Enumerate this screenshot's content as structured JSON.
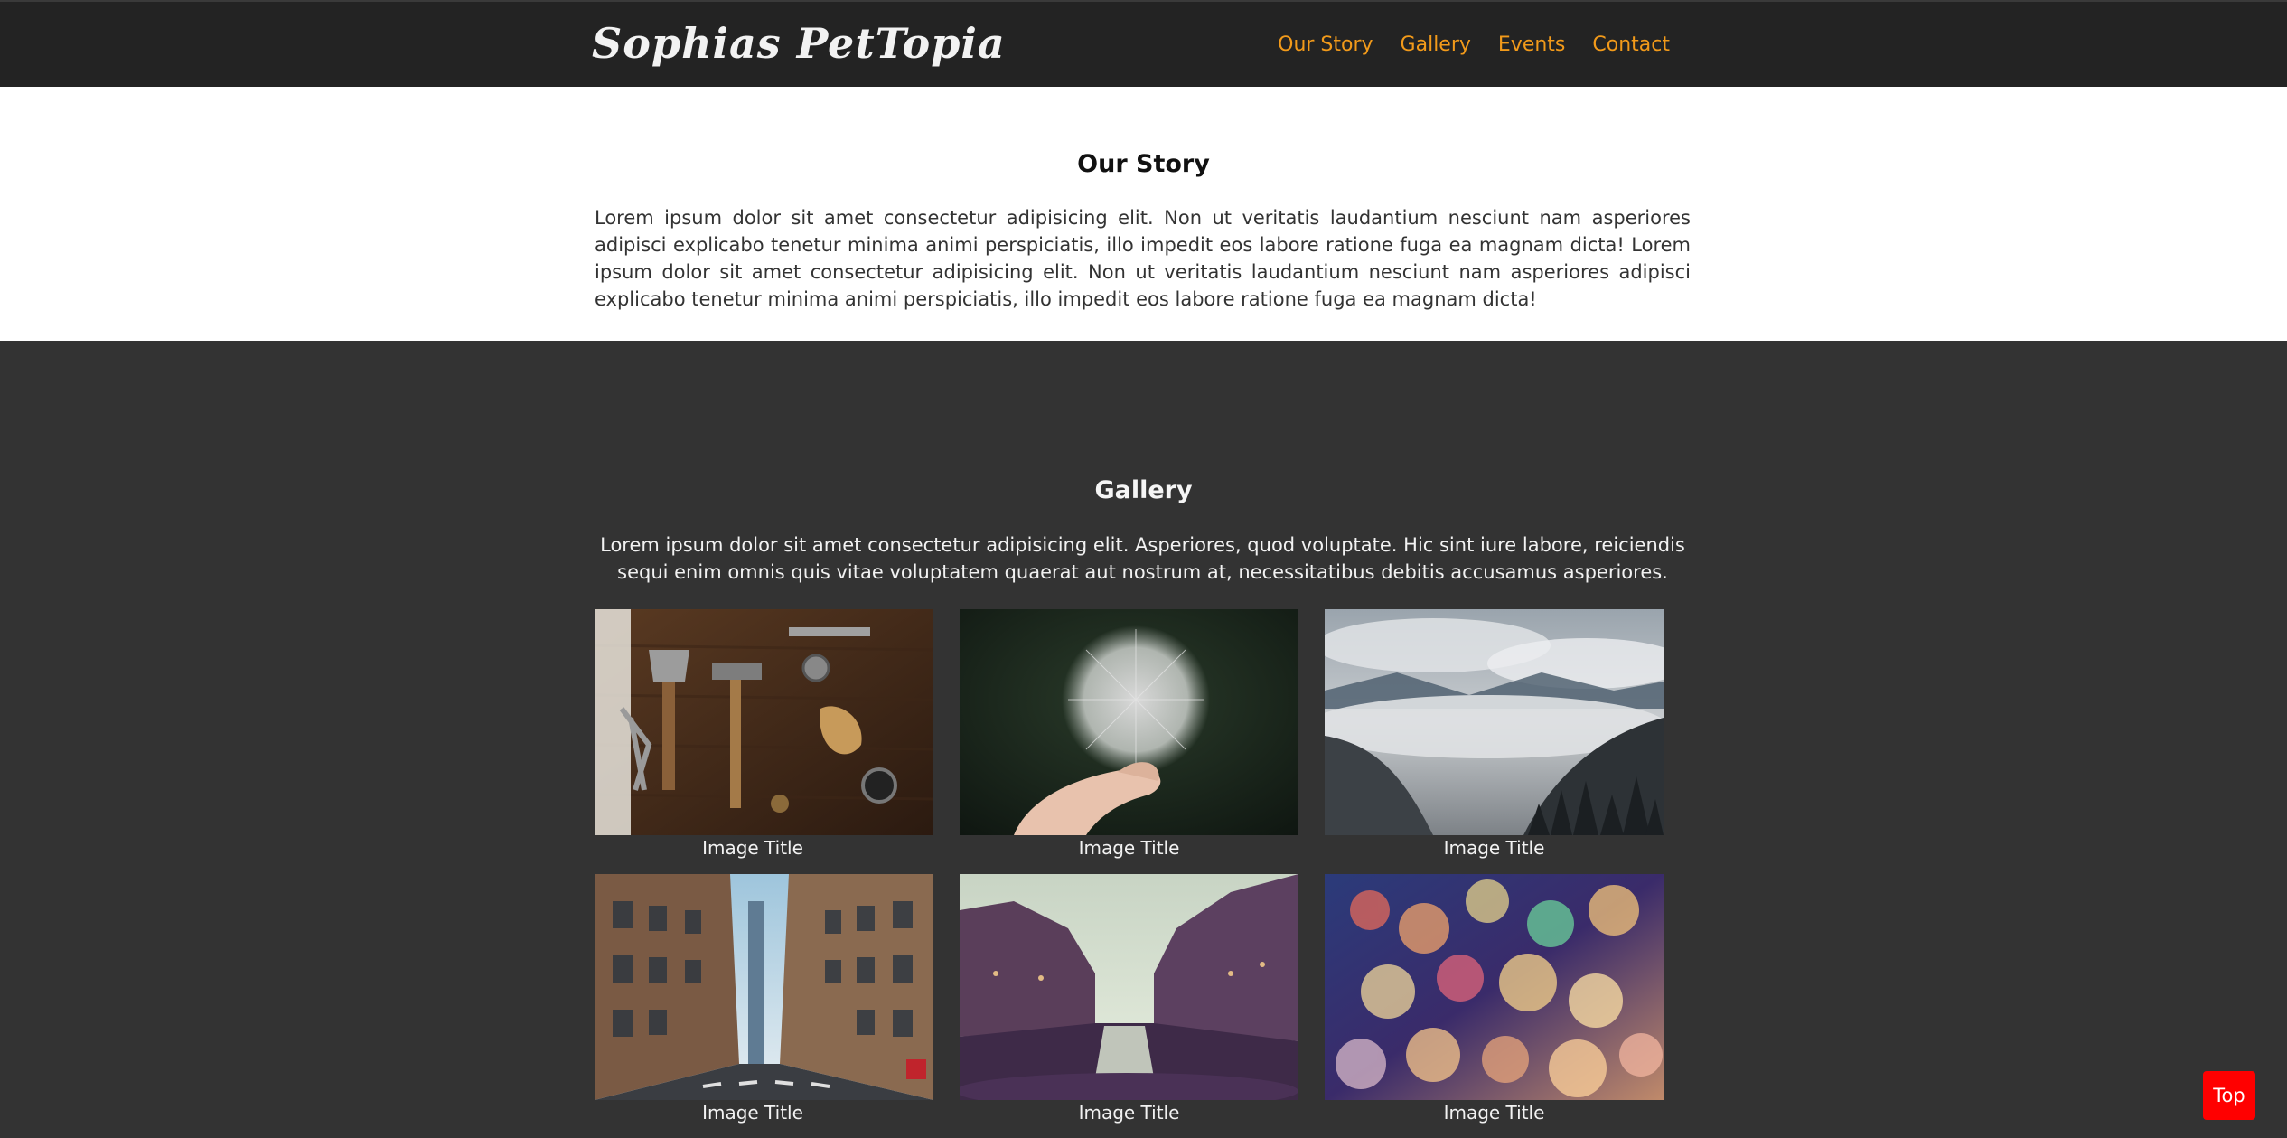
{
  "brand": {
    "name": "Sophias PetTopia"
  },
  "nav": {
    "items": [
      {
        "label": "Our Story"
      },
      {
        "label": "Gallery"
      },
      {
        "label": "Events"
      },
      {
        "label": "Contact"
      }
    ]
  },
  "story": {
    "title": "Our Story",
    "text": "Lorem ipsum dolor sit amet consectetur adipisicing elit. Non ut veritatis laudantium nesciunt nam asperiores adipisci explicabo tenetur minima animi perspiciatis, illo impedit eos labore ratione fuga ea magnam dicta! Lorem ipsum dolor sit amet consectetur adipisicing elit. Non ut veritatis laudantium nesciunt nam asperiores adipisci explicabo tenetur minima animi perspiciatis, illo impedit eos labore ratione fuga ea magnam dicta!"
  },
  "gallery": {
    "title": "Gallery",
    "intro": "Lorem ipsum dolor sit amet consectetur adipisicing elit. Asperiores, quod voluptate. Hic sint iure labore, reiciendis sequi enim omnis quis vitae voluptatem quaerat aut nostrum at, necessitatibus debitis accusamus asperiores.",
    "items": [
      {
        "caption": "Image Title",
        "image": "tools-on-wood"
      },
      {
        "caption": "Image Title",
        "image": "dandelion-in-hand"
      },
      {
        "caption": "Image Title",
        "image": "misty-mountains"
      },
      {
        "caption": "Image Title",
        "image": "city-street"
      },
      {
        "caption": "Image Title",
        "image": "canal-city"
      },
      {
        "caption": "Image Title",
        "image": "bokeh-lights"
      }
    ]
  },
  "top_button": {
    "label": "Top"
  },
  "colors": {
    "nav_background": "#232323",
    "nav_link": "#f29a1a",
    "gallery_background": "#333333",
    "top_button": "#ff0000"
  }
}
